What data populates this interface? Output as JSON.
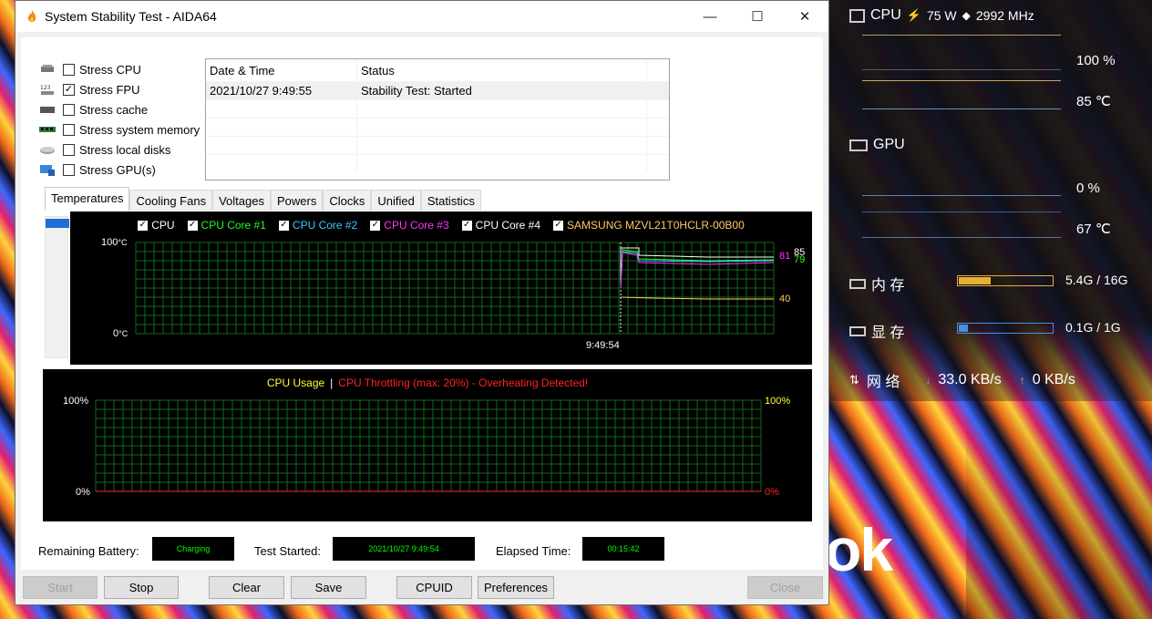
{
  "window": {
    "title": "System Stability Test - AIDA64",
    "minimize": "—",
    "maximize": "☐",
    "close": "✕"
  },
  "stress": [
    {
      "label": "Stress CPU",
      "checked": false
    },
    {
      "label": "Stress FPU",
      "checked": true
    },
    {
      "label": "Stress cache",
      "checked": false
    },
    {
      "label": "Stress system memory",
      "checked": false
    },
    {
      "label": "Stress local disks",
      "checked": false
    },
    {
      "label": "Stress GPU(s)",
      "checked": false
    }
  ],
  "log": {
    "headers": [
      "Date & Time",
      "Status"
    ],
    "rows": [
      {
        "time": "2021/10/27 9:49:55",
        "status": "Stability Test: Started"
      }
    ]
  },
  "tabs": [
    "Temperatures",
    "Cooling Fans",
    "Voltages",
    "Powers",
    "Clocks",
    "Unified",
    "Statistics"
  ],
  "temp_graph": {
    "legend": [
      {
        "name": "CPU",
        "color": "#ffffff"
      },
      {
        "name": "CPU Core #1",
        "color": "#22ff22"
      },
      {
        "name": "CPU Core #2",
        "color": "#33ccff"
      },
      {
        "name": "CPU Core #3",
        "color": "#ff33ff"
      },
      {
        "name": "CPU Core #4",
        "color": "#ffffff"
      },
      {
        "name": "SAMSUNG MZVL21T0HCLR-00B00",
        "color": "#ffcc66"
      }
    ],
    "y_top": "100",
    "y_bottom": "0",
    "unit": "°C",
    "time_label": "9:49:54",
    "right_values": {
      "a": "85",
      "b": "81",
      "c": "79",
      "d": "40"
    }
  },
  "cpu_graph": {
    "title_usage": "CPU Usage",
    "separator": "|",
    "title_throttle": "CPU Throttling (max: 20%) - Overheating Detected!",
    "left_top": "100%",
    "left_bottom": "0%",
    "right_top": "100%",
    "right_bottom": "0%"
  },
  "status": {
    "battery_label": "Remaining Battery:",
    "battery_value": "Charging",
    "started_label": "Test Started:",
    "started_value": "2021/10/27 9:49:54",
    "elapsed_label": "Elapsed Time:",
    "elapsed_value": "00:15:42"
  },
  "buttons": {
    "start": "Start",
    "stop": "Stop",
    "clear": "Clear",
    "save": "Save",
    "cpuid": "CPUID",
    "preferences": "Preferences",
    "close": "Close"
  },
  "monitor": {
    "cpu_label": "CPU",
    "cpu_power": "75 W",
    "cpu_clock": "2992 MHz",
    "cpu_load": "100 %",
    "cpu_temp": "85 ℃",
    "gpu_label": "GPU",
    "gpu_load": "0 %",
    "gpu_temp": "67 ℃",
    "mem_label": "内 存",
    "mem_value": "5.4G / 16G",
    "mem_fraction": 0.34,
    "vram_label": "显 存",
    "vram_value": "0.1G / 1G",
    "vram_fraction": 0.1,
    "net_label": "网 络",
    "net_down": "33.0 KB/s",
    "net_up": "0 KB/s",
    "brand_fragment": "ok"
  }
}
